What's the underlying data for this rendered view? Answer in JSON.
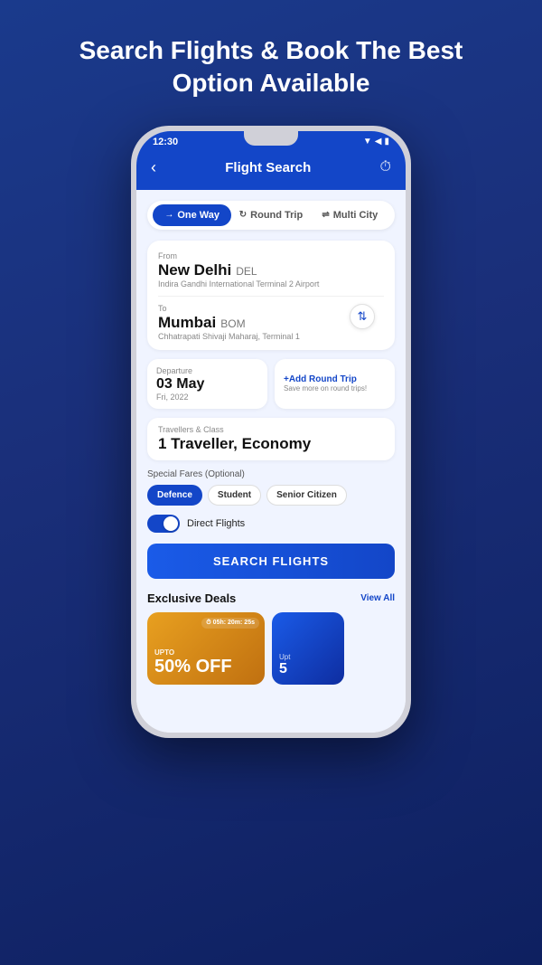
{
  "hero": {
    "title": "Search Flights & Book The Best Option Available"
  },
  "status_bar": {
    "time": "12:30",
    "icons": "▼◀ ▮"
  },
  "app_header": {
    "title": "Flight Search",
    "back_icon": "‹",
    "history_icon": "⏱"
  },
  "tabs": [
    {
      "label": "One Way",
      "icon": "→",
      "active": true
    },
    {
      "label": "Round Trip",
      "icon": "↻",
      "active": false
    },
    {
      "label": "Multi City",
      "icon": "⇌",
      "active": false
    }
  ],
  "from_field": {
    "label": "From",
    "city": "New Delhi",
    "code": "DEL",
    "airport": "Indira Gandhi International Terminal 2 Airport"
  },
  "to_field": {
    "label": "To",
    "city": "Mumbai",
    "code": "BOM",
    "airport": "Chhatrapati Shivaji Maharaj, Terminal 1"
  },
  "departure": {
    "label": "Departure",
    "date": "03 May",
    "day": "Fri, 2022"
  },
  "round_trip": {
    "link": "+Add Round Trip",
    "sub": "Save more on round trips!"
  },
  "travellers": {
    "label": "Travellers & Class",
    "value": "1 Traveller, Economy"
  },
  "fares": {
    "label": "Special Fares (Optional)",
    "options": [
      {
        "label": "Defence",
        "active": true
      },
      {
        "label": "Student",
        "active": false
      },
      {
        "label": "Senior Citizen",
        "active": false
      }
    ]
  },
  "direct_flights": {
    "label": "Direct Flights",
    "enabled": true
  },
  "search_btn": {
    "label": "SEARCH FLIGHTS"
  },
  "exclusive_deals": {
    "title": "Exclusive Deals",
    "view_all": "View All"
  },
  "deals": [
    {
      "upto": "UPTO",
      "percent": "50% OFF",
      "timer": "⏱ 05h: 20m: 25s",
      "type": "warm"
    },
    {
      "upto": "Upt",
      "percent": "5",
      "type": "blue"
    }
  ]
}
